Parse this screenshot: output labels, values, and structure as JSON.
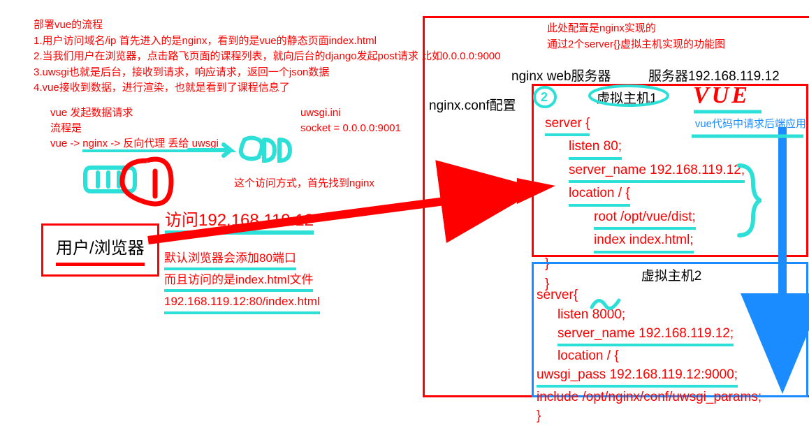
{
  "title": "部署vue的流程",
  "steps": [
    "1.用户访问域名/ip 首先进入的是nginx，看到的是vue的静态页面index.html",
    "2.当我们用户在浏览器，点击路飞页面的课程列表，就向后台的django发起post请求 比如0.0.0.0:9000",
    "3.uwsgi也就是后台，接收到请求，响应请求，返回一个json数据",
    "4.vue接收到数据，进行渲染，也就是看到了课程信息了"
  ],
  "vueFlow": {
    "line1": "vue 发起数据请求",
    "line2": "流程是",
    "line3_prefix": "vue -> ",
    "line3_nginx": "nginx -> 反向代理 丢给",
    "line3_uwsgi": " uwsgi"
  },
  "uwsgiIni": {
    "title": "uwsgi.ini",
    "socket": "socket = 0.0.0.0:9001"
  },
  "accessNote": "这个访问方式，首先找到nginx",
  "accessIp": "访问192.168.119.12",
  "defaultPort": {
    "l1": "默认浏览器会添加80端口",
    "l2": "而且访问的是index.html文件",
    "l3": "192.168.119.12:80/index.html"
  },
  "userBrowser": "用户/浏览器",
  "topRight": {
    "l1": "此处配置是nginx实现的",
    "l2": "通过2个server{}虚拟主机实现的功能图"
  },
  "server": {
    "webLabel": "nginx web服务器",
    "ipLabel": "服务器192.168.119.12",
    "confLabel": "nginx.conf配置"
  },
  "host1": {
    "title": "虚拟主机1",
    "vue": "VUE",
    "reqBackend": "vue代码中请求后端应用",
    "server": "server {",
    "listen": "listen 80;",
    "serverName": "server_name 192.168.119.12;",
    "location": "location / {",
    "root": "root /opt/vue/dist;",
    "index": "index index.html;",
    "close1": "}",
    "close2": "}"
  },
  "host2": {
    "title": "虚拟主机2",
    "server": "server{",
    "listen": "listen 8000;",
    "serverName": "server_name 192.168.119.12;",
    "location": "location / {",
    "uwsgiPass": "uwsgi_pass 192.168.119.12:9000;",
    "include": "include /opt/nginx/conf/uwsgi_params;",
    "close": "}"
  }
}
